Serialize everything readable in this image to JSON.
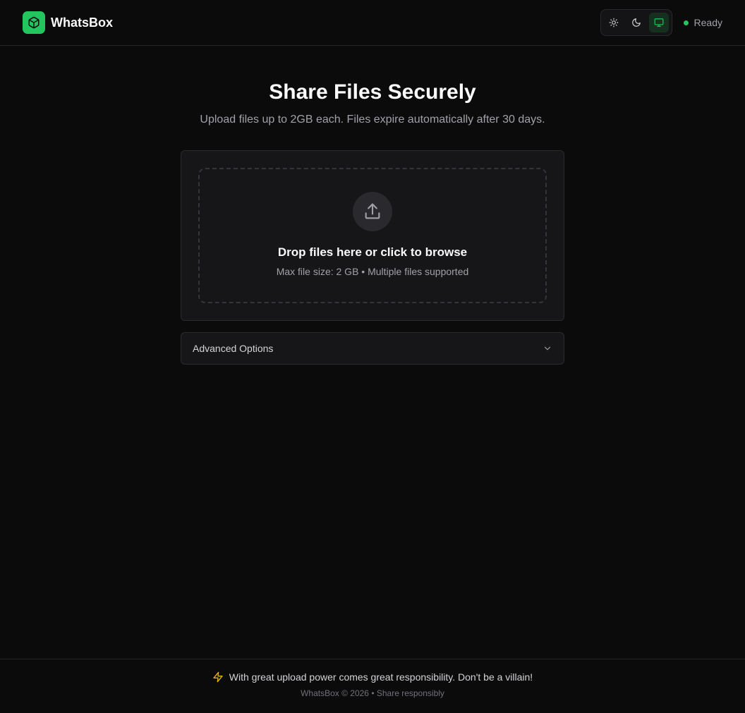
{
  "header": {
    "brand_name": "WhatsBox",
    "theme_options": [
      "light",
      "dark",
      "system"
    ],
    "active_theme": "system",
    "status_text": "Ready"
  },
  "hero": {
    "title": "Share Files Securely",
    "subtitle": "Upload files up to 2GB each. Files expire automatically after 30 days."
  },
  "dropzone": {
    "title": "Drop files here or click to browse",
    "subtitle": "Max file size: 2 GB • Multiple files supported"
  },
  "advanced": {
    "label": "Advanced Options"
  },
  "footer": {
    "message": "With great upload power comes great responsibility. Don't be a villain!",
    "copyright": "WhatsBox © 2026 • Share responsibly"
  },
  "colors": {
    "accent": "#22c55e",
    "warning_icon": "#eab308",
    "background": "#0b0b0c",
    "card": "#161618"
  },
  "icons": {
    "brand": "box-icon",
    "light": "sun-icon",
    "dark": "moon-icon",
    "system": "monitor-icon",
    "upload": "upload-icon",
    "advanced": "chevron-down-icon",
    "footer": "lightning-icon"
  }
}
